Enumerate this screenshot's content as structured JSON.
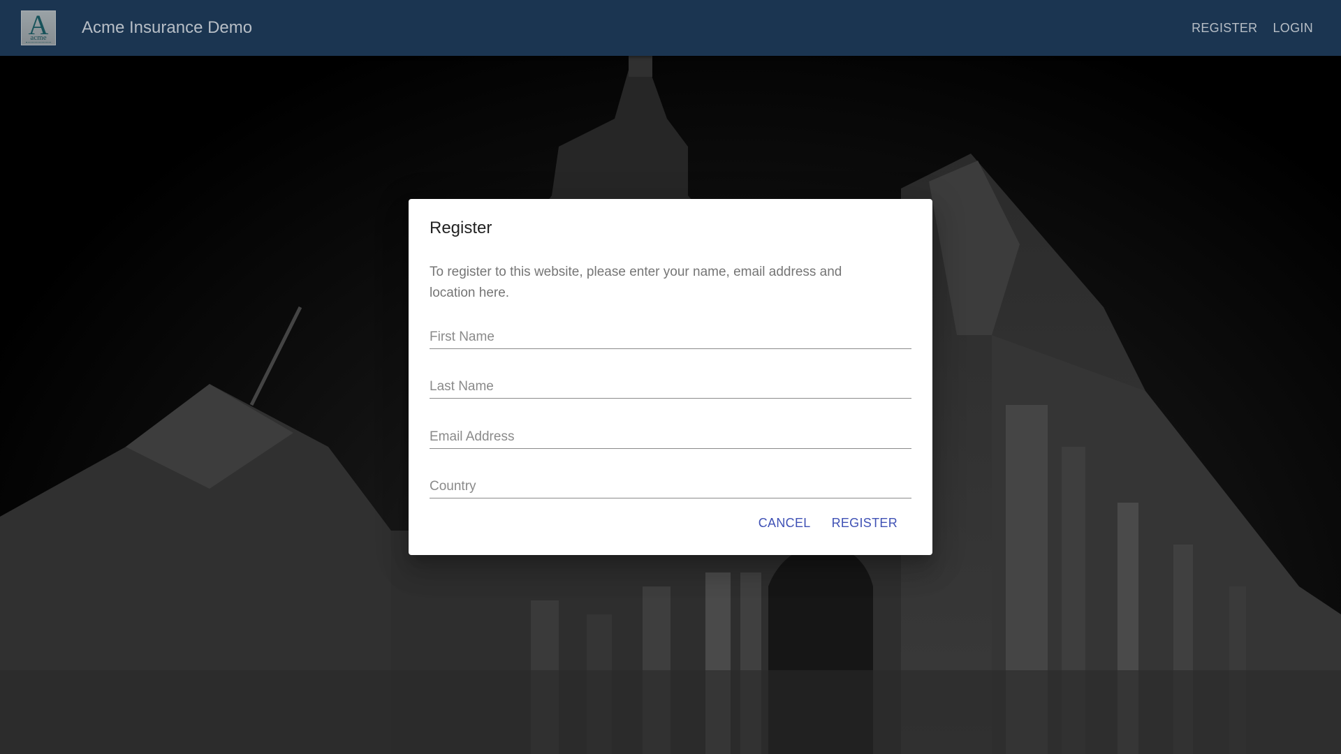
{
  "appbar": {
    "logo": {
      "letter": "A",
      "word": "acme"
    },
    "title": "Acme Insurance Demo",
    "nav": {
      "register": "REGISTER",
      "login": "LOGIN"
    }
  },
  "dialog": {
    "title": "Register",
    "description": "To register to this website, please enter your name, email address and location here.",
    "fields": {
      "first_name": {
        "placeholder": "First Name",
        "value": ""
      },
      "last_name": {
        "placeholder": "Last Name",
        "value": ""
      },
      "email": {
        "placeholder": "Email Address",
        "value": ""
      },
      "country": {
        "placeholder": "Country",
        "value": ""
      }
    },
    "actions": {
      "cancel": "CANCEL",
      "register": "REGISTER"
    }
  },
  "colors": {
    "appbar": "#1b3551",
    "appbar_text": "#b7bec6",
    "accent": "#3f51b5",
    "dialog_bg": "#ffffff"
  }
}
